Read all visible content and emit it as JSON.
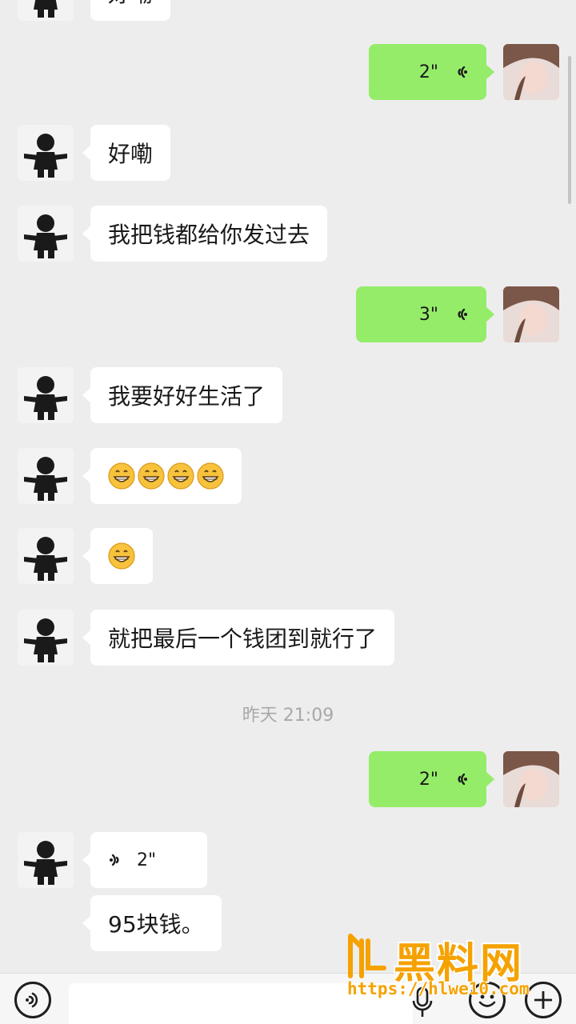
{
  "chat": {
    "messages": [
      {
        "side": "in",
        "kind": "text",
        "text": "好嘞"
      },
      {
        "side": "out",
        "kind": "voice",
        "duration": "2\""
      },
      {
        "side": "in",
        "kind": "text",
        "text": "好嘞"
      },
      {
        "side": "in",
        "kind": "text",
        "text": "我把钱都给你发过去"
      },
      {
        "side": "out",
        "kind": "voice",
        "duration": "3\""
      },
      {
        "side": "in",
        "kind": "text",
        "text": "我要好好生活了"
      },
      {
        "side": "in",
        "kind": "emoji",
        "emoji": "grinning-face",
        "count": 4
      },
      {
        "side": "in",
        "kind": "emoji",
        "emoji": "grinning-face",
        "count": 1
      },
      {
        "side": "in",
        "kind": "text",
        "text": "就把最后一个钱团到就行了"
      },
      {
        "side": "out",
        "kind": "voice",
        "duration": "2\""
      },
      {
        "side": "in",
        "kind": "voice",
        "duration": "2\""
      },
      {
        "side": "in",
        "kind": "text",
        "text": "95块钱。"
      }
    ],
    "timestamp": "昨天 21:09"
  },
  "input_bar": {
    "voice_toggle_icon": "voice-wave-icon",
    "emoji_icon": "smiley-icon",
    "more_icon": "plus-icon",
    "mic_icon": "microphone-icon"
  },
  "watermark": {
    "title": "黑料网",
    "url": "https://hlwe10.com"
  },
  "colors": {
    "background": "#ededed",
    "incoming_bubble": "#ffffff",
    "outgoing_bubble": "#95ec69",
    "watermark": "#f5a200"
  }
}
